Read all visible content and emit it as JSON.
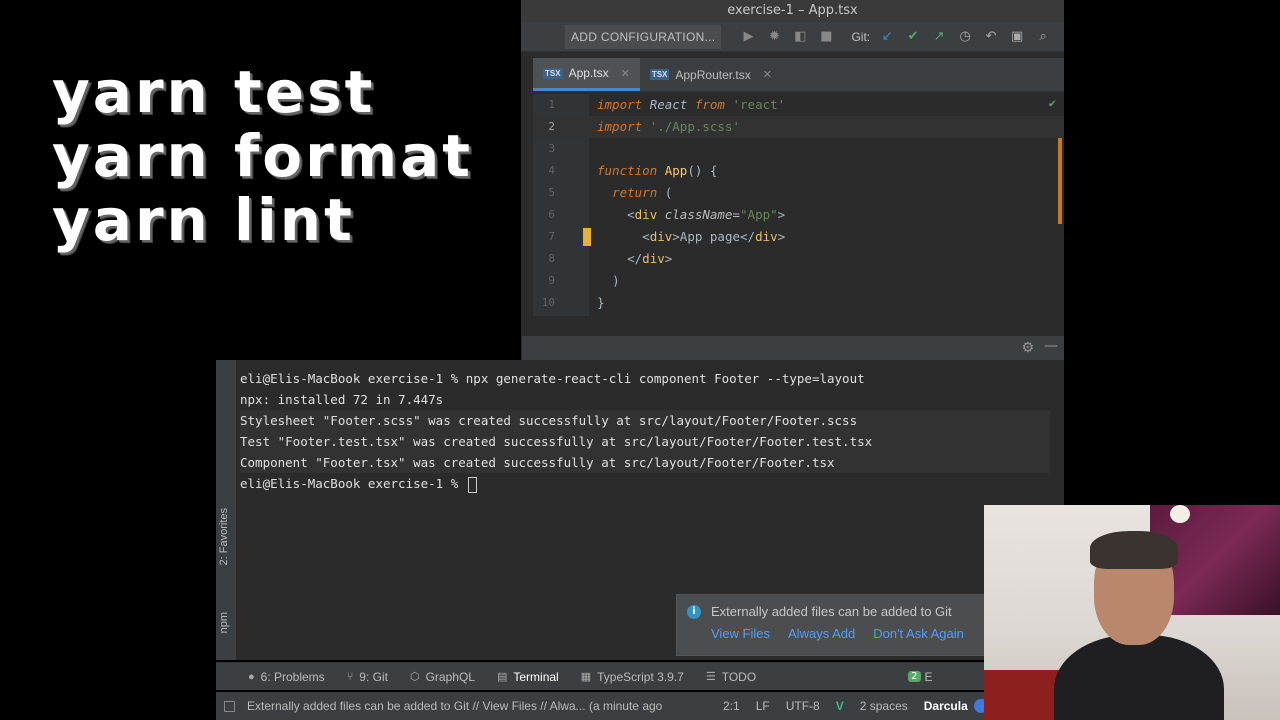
{
  "overlay": {
    "lines": [
      "yarn test",
      "yarn format",
      "yarn lint"
    ]
  },
  "ide": {
    "window_title": "exercise-1 – App.tsx",
    "toolbar": {
      "add_config": "ADD CONFIGURATION...",
      "git_label": "Git:"
    },
    "tabs": [
      {
        "label": "App.tsx",
        "icon": "TSX"
      },
      {
        "label": "AppRouter.tsx",
        "icon": "TSX"
      }
    ],
    "code": {
      "line_numbers": [
        "1",
        "2",
        "3",
        "4",
        "5",
        "6",
        "7",
        "8",
        "9",
        "10"
      ],
      "l1": {
        "kw": "import",
        "id": "React",
        "kw2": "from",
        "str": "'react'"
      },
      "l2": {
        "kw": "import",
        "str": "'./App.scss'"
      },
      "l4": {
        "kw": "function",
        "fn": "App",
        "rest": "() {"
      },
      "l5": {
        "kw": "return",
        "rest": " ("
      },
      "l6": {
        "open": "<",
        "tag": "div",
        "attr": "className",
        "eq": "=",
        "str": "\"App\"",
        "close": ">"
      },
      "l7": {
        "open": "<",
        "tag": "div",
        "mid": ">",
        "text": "App page",
        "end_open": "</",
        "end_tag": "div",
        "end_close": ">"
      },
      "l8": {
        "open": "</",
        "tag": "div",
        "close": ">"
      },
      "l9": {
        "text": ")"
      },
      "l10": {
        "text": "}"
      }
    }
  },
  "terminal": {
    "lines": [
      "eli@Elis-MacBook exercise-1 % npx generate-react-cli component Footer --type=layout",
      "npx: installed 72 in 7.447s",
      "Stylesheet \"Footer.scss\" was created successfully at src/layout/Footer/Footer.scss",
      "Test \"Footer.test.tsx\" was created successfully at src/layout/Footer/Footer.test.tsx",
      "Component \"Footer.tsx\" was created successfully at src/layout/Footer/Footer.tsx"
    ],
    "prompt": "eli@Elis-MacBook exercise-1 % "
  },
  "side_tabs": {
    "favorites": "2: Favorites",
    "npm": "npm"
  },
  "notification": {
    "message": "Externally added files can be added to Git",
    "actions": [
      "View Files",
      "Always Add",
      "Don't Ask Again"
    ]
  },
  "bottom_tabs": [
    {
      "label": "6: Problems",
      "icon": "problems-icon"
    },
    {
      "label": "9: Git",
      "icon": "git-branch-icon"
    },
    {
      "label": "GraphQL",
      "icon": "graphql-icon"
    },
    {
      "label": "Terminal",
      "icon": "terminal-icon"
    },
    {
      "label": "TypeScript 3.9.7",
      "icon": "typescript-icon"
    },
    {
      "label": "TODO",
      "icon": "todo-icon"
    }
  ],
  "bottom_event_badge": "2",
  "bottom_event_label": "E",
  "statusbar": {
    "message": "Externally added files can be added to Git // View Files // Alwa... (a minute ago",
    "position": "2:1",
    "line_sep": "LF",
    "encoding": "UTF-8",
    "indent": "2 spaces",
    "theme": "Darcula"
  }
}
